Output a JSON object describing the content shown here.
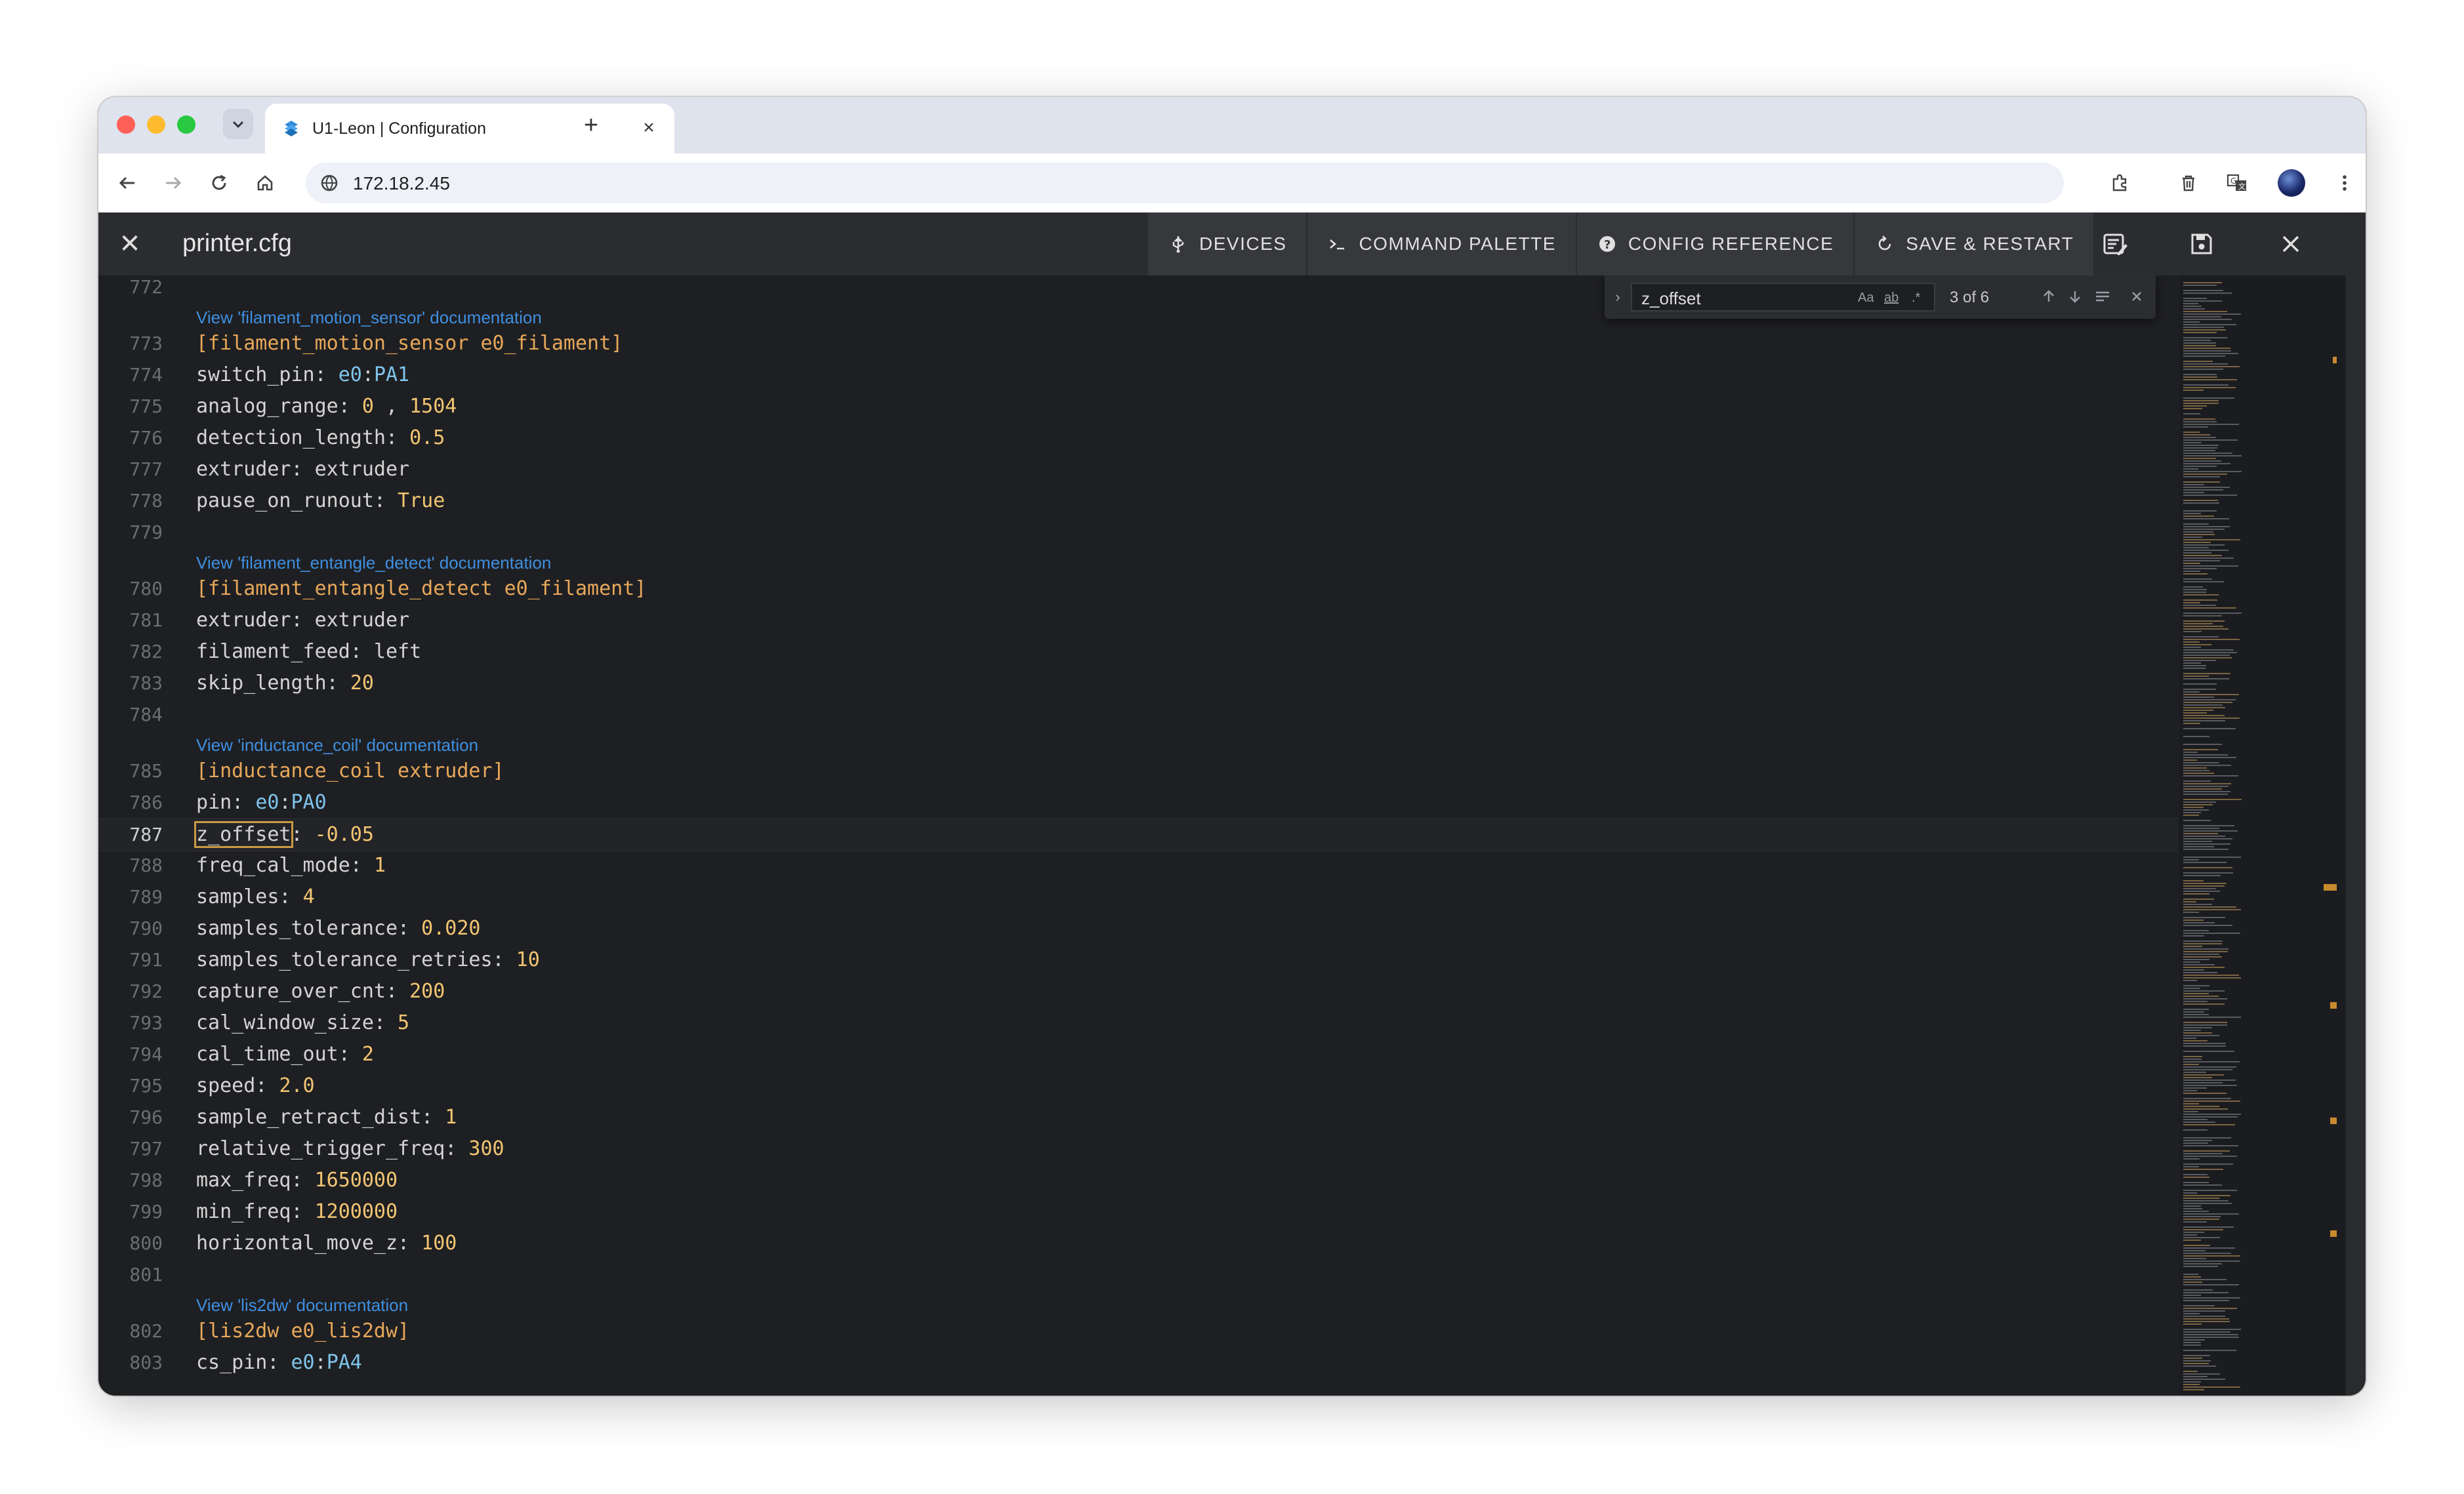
{
  "browser": {
    "tab_title": "U1-Leon | Configuration",
    "url": "172.18.2.45",
    "icons": {
      "back": "back-arrow-icon",
      "forward": "forward-arrow-icon",
      "reload": "reload-icon",
      "home": "home-icon",
      "site_info": "site-info-icon",
      "extensions": "extensions-icon",
      "delete": "trash-icon",
      "translate": "translate-icon",
      "menu": "kebab-menu-icon"
    }
  },
  "app": {
    "file_name": "printer.cfg",
    "buttons": {
      "devices": "DEVICES",
      "command_palette": "COMMAND PALETTE",
      "config_reference": "CONFIG REFERENCE",
      "save_restart": "SAVE & RESTART"
    }
  },
  "find": {
    "query": "z_offset",
    "count": "3 of 6",
    "match_case": "Aa",
    "whole_word": "ab",
    "regex": ".*"
  },
  "editor": {
    "lines": [
      {
        "n": "772",
        "parts": []
      },
      {
        "doc": "View 'filament_motion_sensor' documentation"
      },
      {
        "n": "773",
        "parts": [
          {
            "c": "sect",
            "t": "[filament_motion_sensor e0_filament]"
          }
        ]
      },
      {
        "n": "774",
        "parts": [
          {
            "c": "k",
            "t": "switch_pin: "
          },
          {
            "c": "pin",
            "t": "e0"
          },
          {
            "c": "k",
            "t": ":"
          },
          {
            "c": "pin",
            "t": "PA1"
          }
        ]
      },
      {
        "n": "775",
        "parts": [
          {
            "c": "k",
            "t": "analog_range: "
          },
          {
            "c": "v",
            "t": "0"
          },
          {
            "c": "k",
            "t": " , "
          },
          {
            "c": "v",
            "t": "1504"
          }
        ]
      },
      {
        "n": "776",
        "parts": [
          {
            "c": "k",
            "t": "detection_length: "
          },
          {
            "c": "v",
            "t": "0.5"
          }
        ]
      },
      {
        "n": "777",
        "parts": [
          {
            "c": "k",
            "t": "extruder: extruder"
          }
        ]
      },
      {
        "n": "778",
        "parts": [
          {
            "c": "k",
            "t": "pause_on_runout: "
          },
          {
            "c": "v",
            "t": "True"
          }
        ]
      },
      {
        "n": "779",
        "parts": []
      },
      {
        "doc": "View 'filament_entangle_detect' documentation"
      },
      {
        "n": "780",
        "parts": [
          {
            "c": "sect",
            "t": "[filament_entangle_detect e0_filament]"
          }
        ]
      },
      {
        "n": "781",
        "parts": [
          {
            "c": "k",
            "t": "extruder: extruder"
          }
        ]
      },
      {
        "n": "782",
        "parts": [
          {
            "c": "k",
            "t": "filament_feed: left"
          }
        ]
      },
      {
        "n": "783",
        "parts": [
          {
            "c": "k",
            "t": "skip_length: "
          },
          {
            "c": "v",
            "t": "20"
          }
        ]
      },
      {
        "n": "784",
        "parts": []
      },
      {
        "doc": "View 'inductance_coil' documentation"
      },
      {
        "n": "785",
        "parts": [
          {
            "c": "sect",
            "t": "[inductance_coil extruder]"
          }
        ]
      },
      {
        "n": "786",
        "parts": [
          {
            "c": "k",
            "t": "pin: "
          },
          {
            "c": "pin",
            "t": "e0"
          },
          {
            "c": "k",
            "t": ":"
          },
          {
            "c": "pin",
            "t": "PA0"
          }
        ]
      },
      {
        "n": "787",
        "active": true,
        "parts": [
          {
            "c": "k match",
            "t": "z_offset"
          },
          {
            "c": "k",
            "t": ": "
          },
          {
            "c": "v",
            "t": "-0.05"
          }
        ]
      },
      {
        "n": "788",
        "parts": [
          {
            "c": "k",
            "t": "freq_cal_mode: "
          },
          {
            "c": "v",
            "t": "1"
          }
        ]
      },
      {
        "n": "789",
        "parts": [
          {
            "c": "k",
            "t": "samples: "
          },
          {
            "c": "v",
            "t": "4"
          }
        ]
      },
      {
        "n": "790",
        "parts": [
          {
            "c": "k",
            "t": "samples_tolerance: "
          },
          {
            "c": "v",
            "t": "0.020"
          }
        ]
      },
      {
        "n": "791",
        "parts": [
          {
            "c": "k",
            "t": "samples_tolerance_retries: "
          },
          {
            "c": "v",
            "t": "10"
          }
        ]
      },
      {
        "n": "792",
        "parts": [
          {
            "c": "k",
            "t": "capture_over_cnt: "
          },
          {
            "c": "v",
            "t": "200"
          }
        ]
      },
      {
        "n": "793",
        "parts": [
          {
            "c": "k",
            "t": "cal_window_size: "
          },
          {
            "c": "v",
            "t": "5"
          }
        ]
      },
      {
        "n": "794",
        "parts": [
          {
            "c": "k",
            "t": "cal_time_out: "
          },
          {
            "c": "v",
            "t": "2"
          }
        ]
      },
      {
        "n": "795",
        "parts": [
          {
            "c": "k",
            "t": "speed: "
          },
          {
            "c": "v",
            "t": "2.0"
          }
        ]
      },
      {
        "n": "796",
        "parts": [
          {
            "c": "k",
            "t": "sample_retract_dist: "
          },
          {
            "c": "v",
            "t": "1"
          }
        ]
      },
      {
        "n": "797",
        "parts": [
          {
            "c": "k",
            "t": "relative_trigger_freq: "
          },
          {
            "c": "v",
            "t": "300"
          }
        ]
      },
      {
        "n": "798",
        "parts": [
          {
            "c": "k",
            "t": "max_freq: "
          },
          {
            "c": "v",
            "t": "1650000"
          }
        ]
      },
      {
        "n": "799",
        "parts": [
          {
            "c": "k",
            "t": "min_freq: "
          },
          {
            "c": "v",
            "t": "1200000"
          }
        ]
      },
      {
        "n": "800",
        "parts": [
          {
            "c": "k",
            "t": "horizontal_move_z: "
          },
          {
            "c": "v",
            "t": "100"
          }
        ]
      },
      {
        "n": "801",
        "parts": []
      },
      {
        "doc": "View 'lis2dw' documentation"
      },
      {
        "n": "802",
        "parts": [
          {
            "c": "sect",
            "t": "[lis2dw e0_lis2dw]"
          }
        ]
      },
      {
        "n": "803",
        "parts": [
          {
            "c": "k",
            "t": "cs_pin: "
          },
          {
            "c": "pin",
            "t": "e0"
          },
          {
            "c": "k",
            "t": ":"
          },
          {
            "c": "pin",
            "t": "PA4"
          }
        ]
      }
    ]
  },
  "colors": {
    "accent_match": "#c89a43",
    "doc_link": "#3f8fe0",
    "section": "#e8a85a",
    "value": "#f2c572",
    "pin": "#7fc4ec"
  }
}
